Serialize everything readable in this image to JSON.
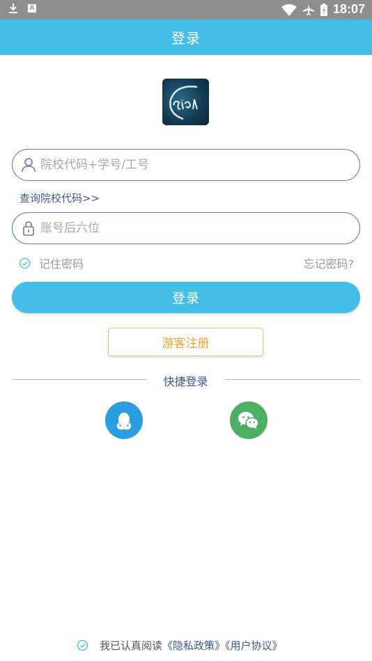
{
  "status_bar": {
    "time": "18:07",
    "notification_badge": "A"
  },
  "header": {
    "title": "登录"
  },
  "account_field": {
    "placeholder": "院校代码+学号/工号",
    "value": ""
  },
  "query_link": "查询院校代码>>",
  "password_field": {
    "placeholder": "账号后六位",
    "value": ""
  },
  "remember_label": "记住密码",
  "forgot_label": "忘记密码?",
  "login_label": "登录",
  "guest_register_label": "游客注册",
  "quick_login_title": "快捷登录",
  "agreement": {
    "prefix": "我已认真阅读",
    "privacy_link": "《隐私政策》",
    "terms_link": "《用户协议》"
  },
  "colors": {
    "primary": "#43bee6",
    "link": "#3d5a98",
    "guest_accent": "#f0a532",
    "qq": "#2a9ee0",
    "wechat": "#4caf63",
    "status_bar": "#8e8e8e"
  },
  "icons": {
    "status_left": [
      "download-icon",
      "a-badge-icon"
    ],
    "status_right": [
      "wifi-icon",
      "airplane-icon",
      "battery-icon"
    ],
    "account": "user-icon",
    "password": "lock-icon",
    "remember": "check-circle-icon",
    "social": [
      "qq-icon",
      "wechat-icon"
    ]
  }
}
